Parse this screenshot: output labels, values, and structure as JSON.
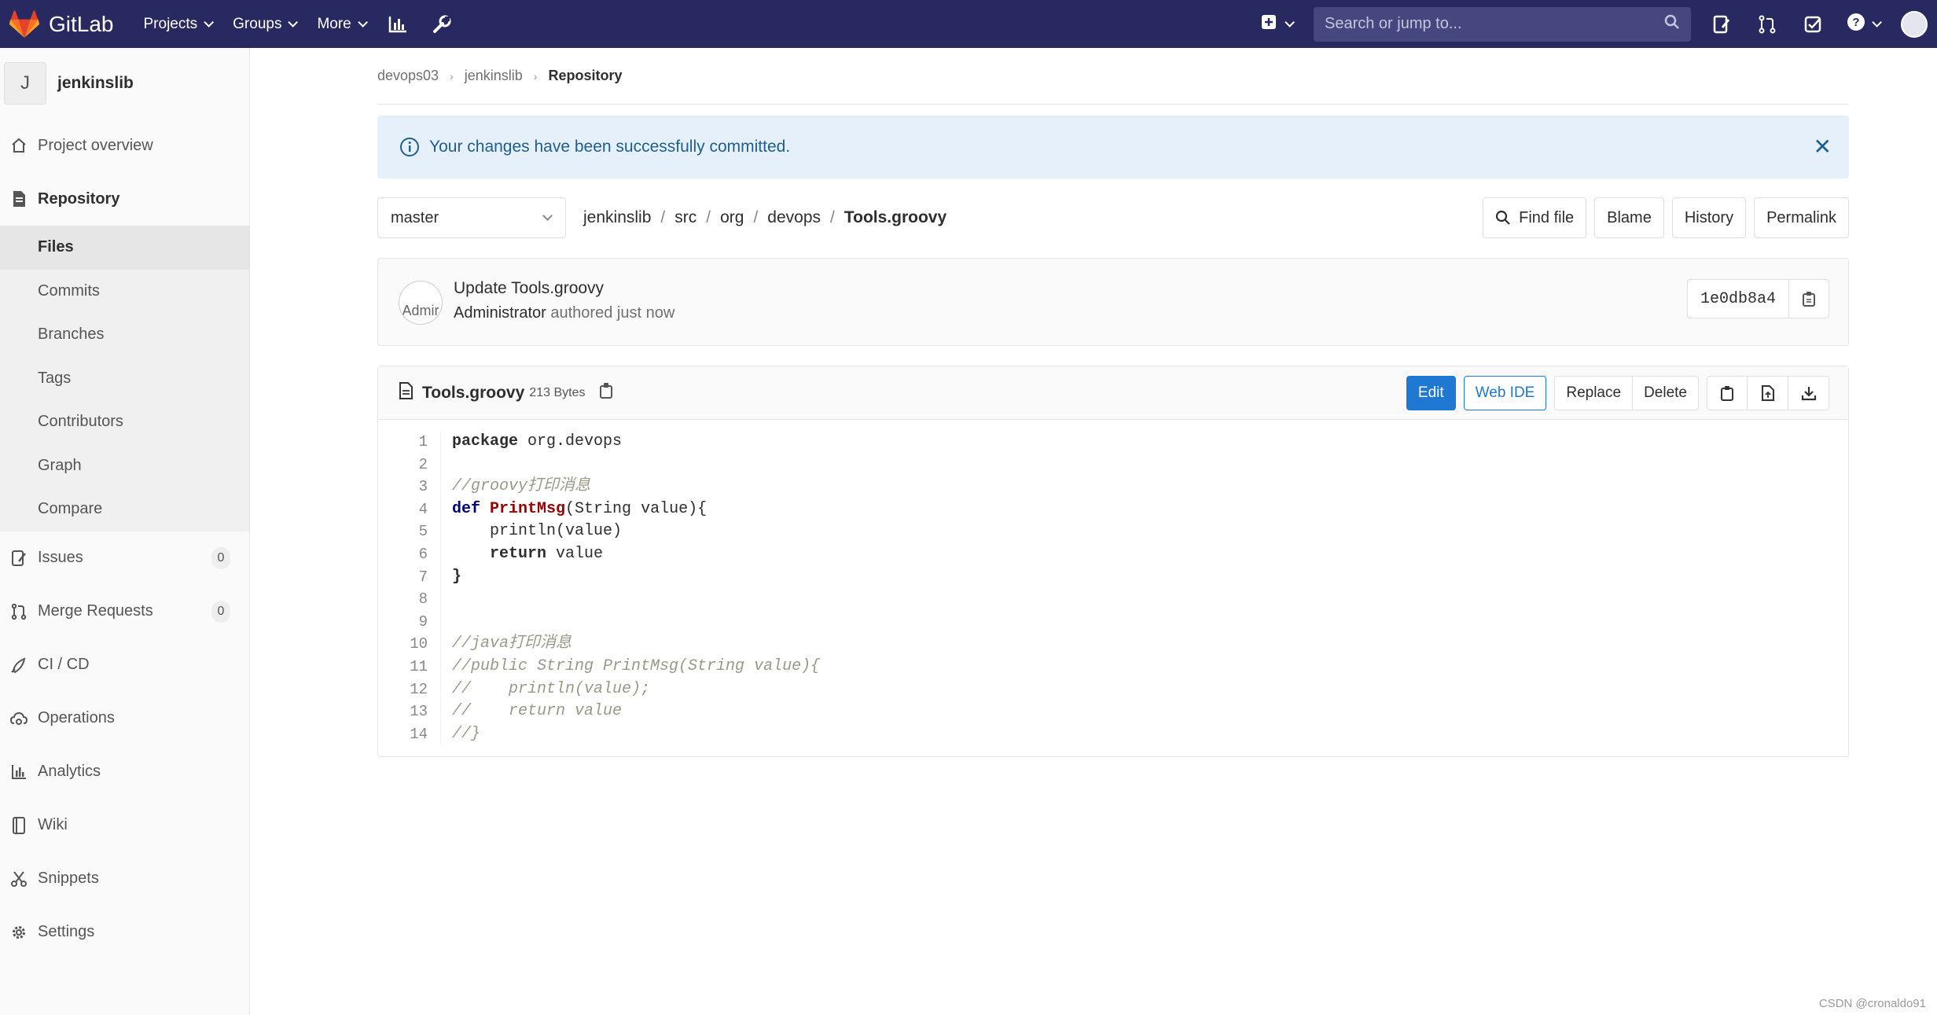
{
  "navbar": {
    "logo_text": "GitLab",
    "menu": [
      "Projects",
      "Groups",
      "More"
    ],
    "search_placeholder": "Search or jump to..."
  },
  "sidebar": {
    "project_initial": "J",
    "project_name": "jenkinslib",
    "items": [
      {
        "label": "Project overview",
        "icon": "home-icon"
      },
      {
        "label": "Repository",
        "icon": "document-icon"
      },
      {
        "label": "Issues",
        "icon": "issues-icon",
        "count": "0"
      },
      {
        "label": "Merge Requests",
        "icon": "merge-request-icon",
        "count": "0"
      },
      {
        "label": "CI / CD",
        "icon": "rocket-icon"
      },
      {
        "label": "Operations",
        "icon": "cloud-gear-icon"
      },
      {
        "label": "Analytics",
        "icon": "chart-icon"
      },
      {
        "label": "Wiki",
        "icon": "book-icon"
      },
      {
        "label": "Snippets",
        "icon": "scissors-icon"
      },
      {
        "label": "Settings",
        "icon": "gear-icon"
      }
    ],
    "repo_sub": [
      "Files",
      "Commits",
      "Branches",
      "Tags",
      "Contributors",
      "Graph",
      "Compare"
    ]
  },
  "breadcrumb": [
    "devops03",
    "jenkinslib",
    "Repository"
  ],
  "flash": {
    "message": "Your changes have been successfully committed."
  },
  "tree": {
    "branch": "master",
    "path": [
      "jenkinslib",
      "src",
      "org",
      "devops"
    ],
    "file": "Tools.groovy",
    "actions": [
      "Find file",
      "Blame",
      "History",
      "Permalink"
    ]
  },
  "commit": {
    "avatar_alt": "Admir",
    "title": "Update Tools.groovy",
    "author": "Administrator",
    "meta": "authored just now",
    "sha": "1e0db8a4"
  },
  "file": {
    "name": "Tools.groovy",
    "size": "213 Bytes",
    "edit_label": "Edit",
    "webide_label": "Web IDE",
    "replace_label": "Replace",
    "delete_label": "Delete"
  },
  "code": {
    "line_numbers": [
      "1",
      "2",
      "3",
      "4",
      "5",
      "6",
      "7",
      "8",
      "9",
      "10",
      "11",
      "12",
      "13",
      "14"
    ],
    "l1_kw": "package",
    "l1_rest": " org.devops",
    "l3": "//groovy打印消息",
    "l4_kw": "def",
    "l4_fn": "PrintMsg",
    "l4_rest": "(String value){",
    "l5": "    println(value)",
    "l6_kw": "return",
    "l6_rest": " value",
    "l7": "}",
    "l10": "//java打印消息",
    "l11": "//public String PrintMsg(String value){",
    "l12": "//    println(value);",
    "l13": "//    return value",
    "l14": "//}"
  },
  "watermark": "CSDN @cronaldo91"
}
